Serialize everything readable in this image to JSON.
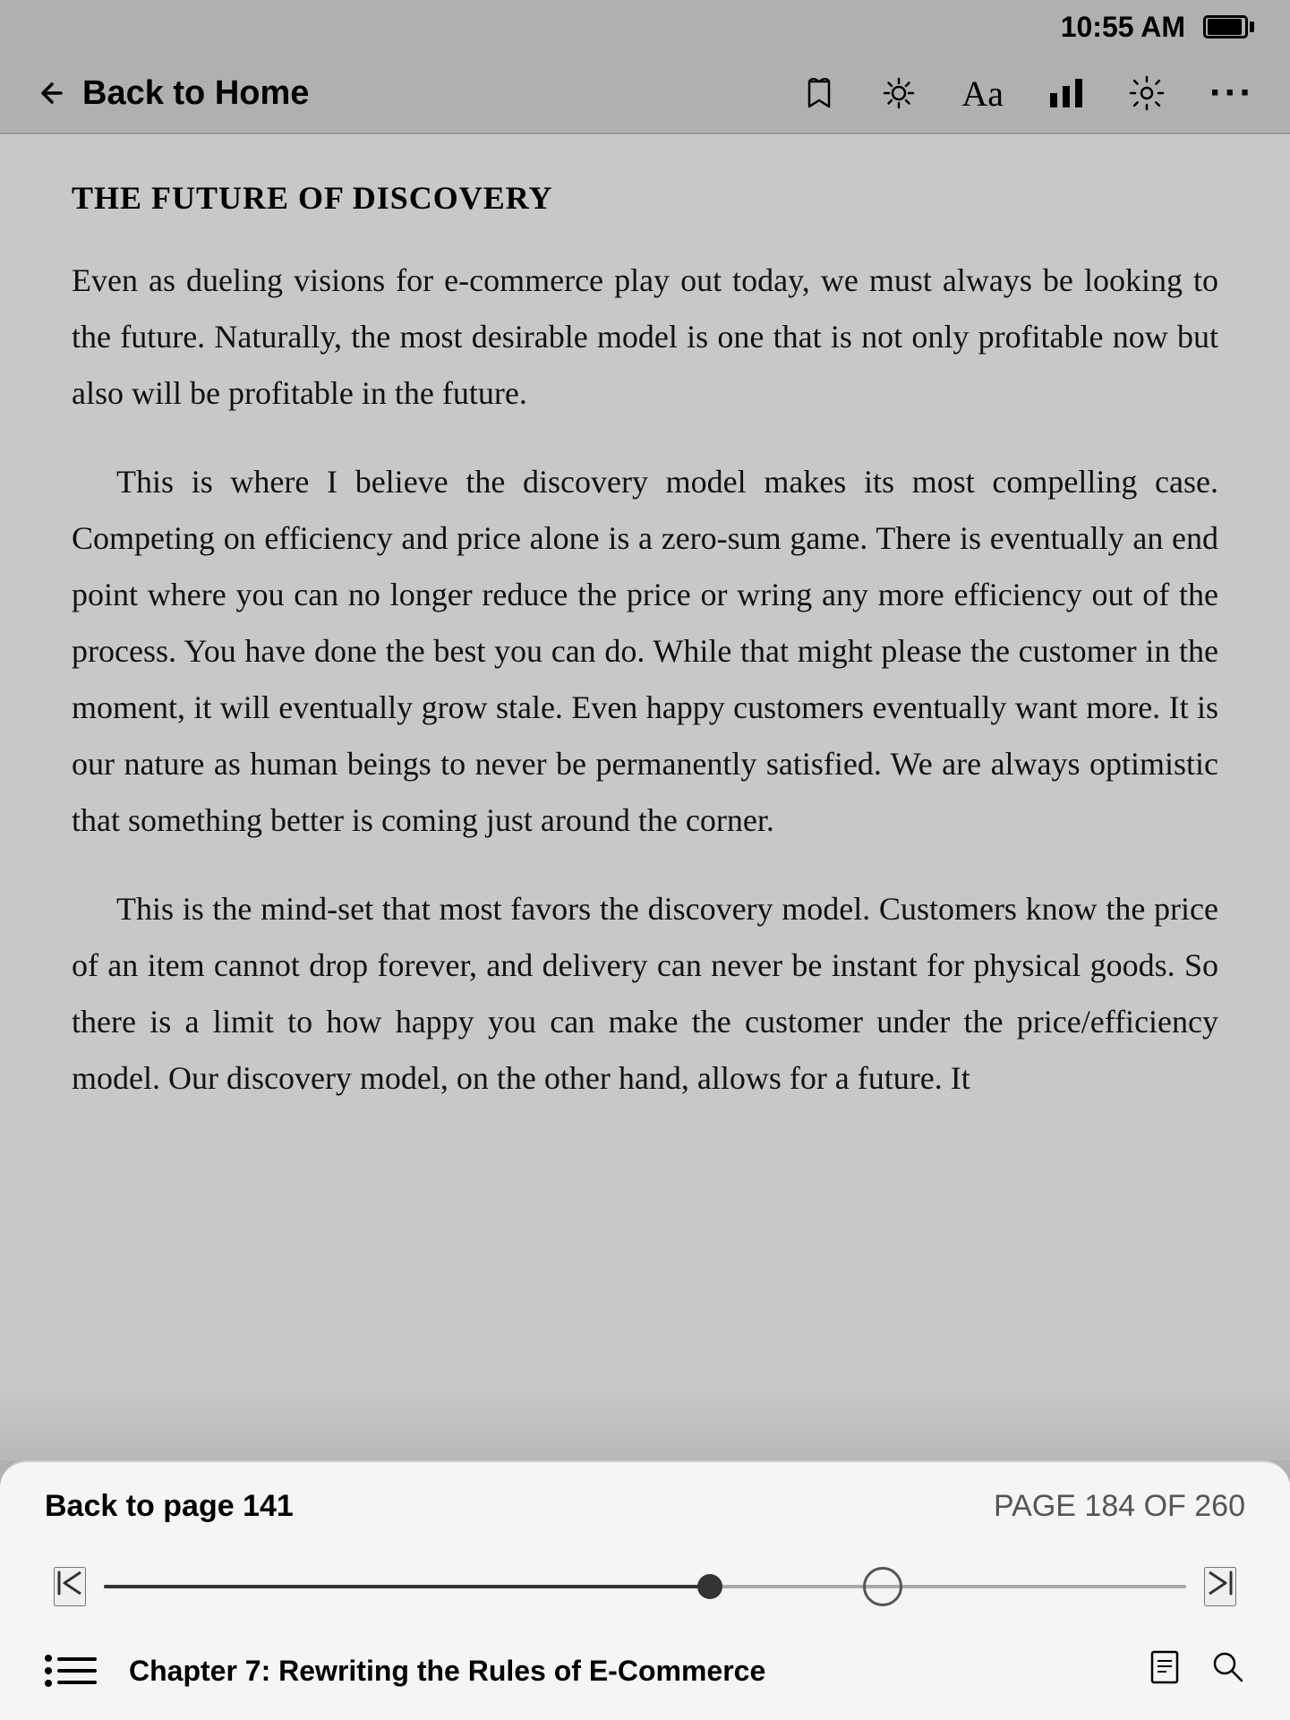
{
  "statusBar": {
    "time": "10:55 AM"
  },
  "navBar": {
    "backLabel": "Back to Home",
    "icons": {
      "bookmark": "🔖",
      "brightness": "☀",
      "font": "Aa",
      "chart": "📊",
      "settings": "⚙",
      "more": "•••"
    }
  },
  "reading": {
    "sectionTitle": "THE FUTURE OF DISCOVERY",
    "paragraphs": [
      "Even as dueling visions for e-commerce play out today, we must always be looking to the future. Naturally, the most desirable model is one that is not only profitable now but also will be profitable in the future.",
      "This is where I believe the discovery model makes its most compelling case. Competing on efficiency and price alone is a zero-sum game. There is eventually an end point where you can no longer reduce the price or wring any more efficiency out of the process. You have done the best you can do. While that might please the customer in the moment, it will eventually grow stale. Even happy customers eventually want more. It is our nature as human beings to never be permanently satisfied. We are always optimistic that something better is coming just around the corner.",
      "This is the mind-set that most favors the discovery model. Customers know the price of an item cannot drop forever, and delivery can never be instant for physical goods. So there is a limit to how happy you can make the customer under the price/efficiency model. Our discovery model, on the other hand, allows for a future. It"
    ]
  },
  "bottomPanel": {
    "backToPage": "Back to page 141",
    "pageCounter": "PAGE 184 OF 260",
    "sliderMin": "|<",
    "sliderMax": ">|",
    "chapterLabel": "Chapter 7: Rewriting the Rules of E-Commerce"
  }
}
